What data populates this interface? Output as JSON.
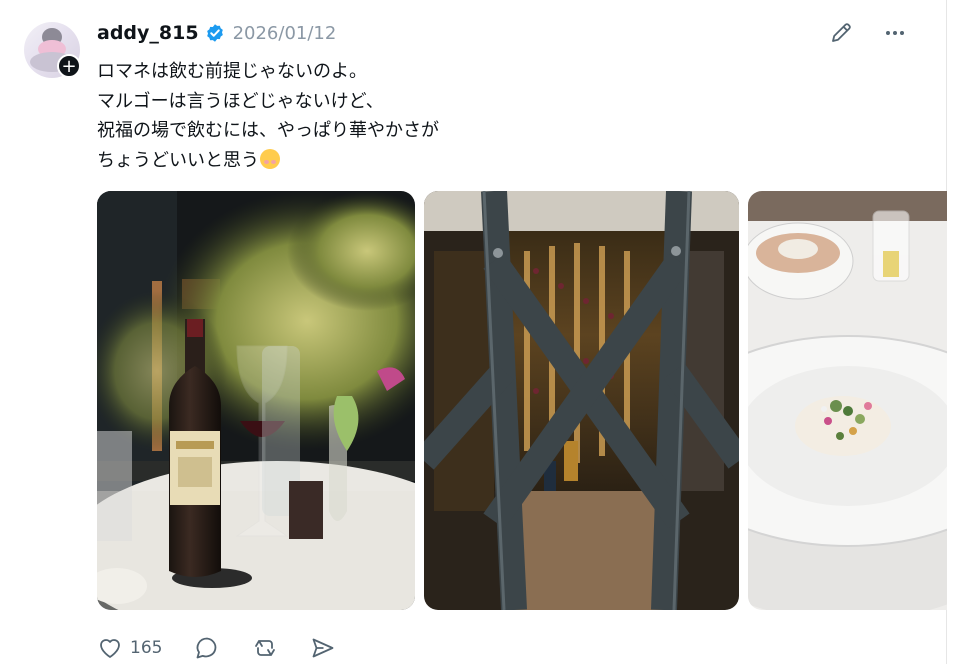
{
  "post": {
    "username": "addy_815",
    "date": "2026/01/12",
    "text_lines": [
      "ロマネは飲む前提じゃないのよ。",
      "マルゴーは言うほどじゃないけど、",
      "祝福の場で飲むには、やっぱり華やかさが",
      "ちょうどいいと思う"
    ],
    "emoji": "smiling-face-icon",
    "photos": [
      "wine-bottle-photo",
      "wine-cellar-photo",
      "plated-dish-photo"
    ]
  },
  "actions": {
    "like_count": "165",
    "icons": [
      "heart-icon",
      "reply-icon",
      "repost-icon",
      "share-icon"
    ]
  },
  "header_icons": [
    "verified-badge-icon",
    "pencil-icon",
    "more-icon",
    "plus-icon"
  ],
  "colors": {
    "verified": "#1d9bf0",
    "muted": "#8b98a5",
    "text": "#0f1419"
  }
}
